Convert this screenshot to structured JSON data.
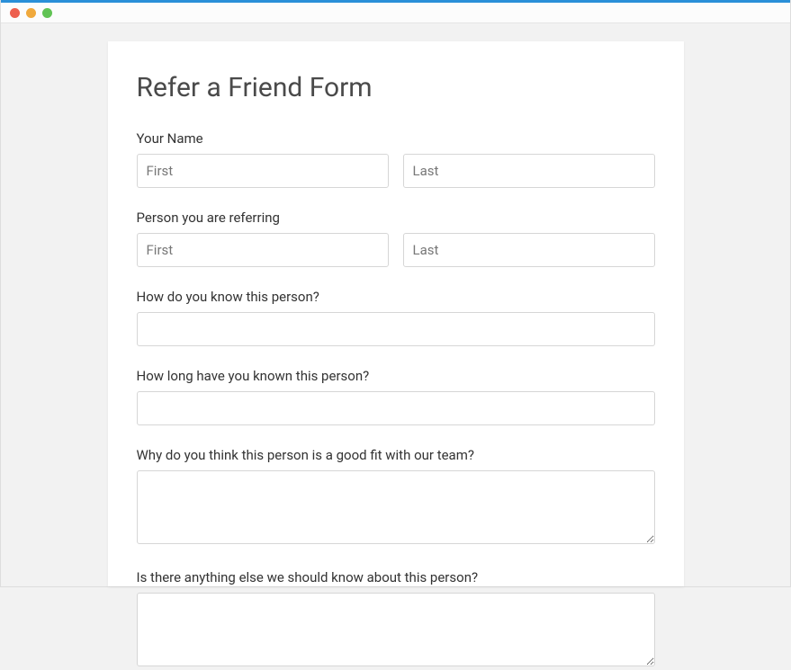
{
  "form": {
    "title": "Refer a Friend Form",
    "fields": {
      "your_name": {
        "label": "Your Name",
        "first_placeholder": "First",
        "last_placeholder": "Last"
      },
      "referring": {
        "label": "Person you are referring",
        "first_placeholder": "First",
        "last_placeholder": "Last"
      },
      "how_know": {
        "label": "How do you know this person?"
      },
      "how_long": {
        "label": "How long have you known this person?"
      },
      "good_fit": {
        "label": "Why do you think this person is a good fit with our team?"
      },
      "anything_else": {
        "label": "Is there anything else we should know about this person?"
      }
    }
  }
}
